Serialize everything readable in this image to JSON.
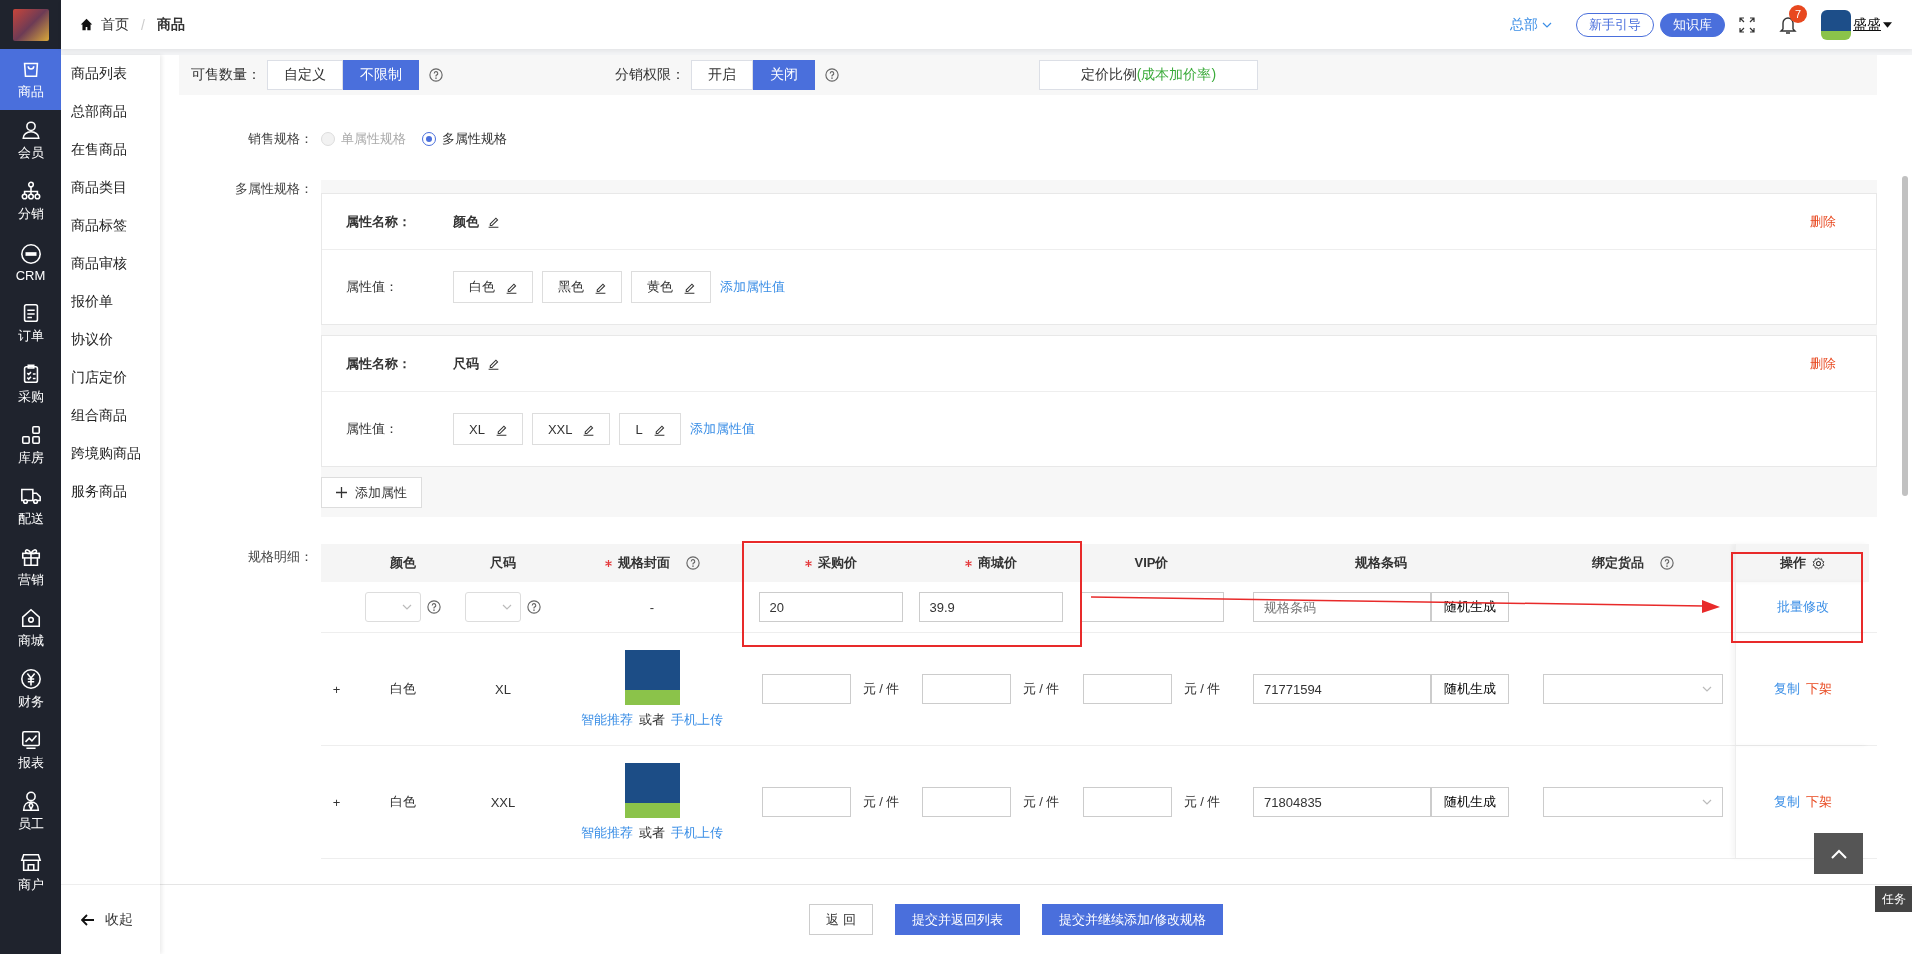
{
  "header": {
    "breadcrumb": [
      {
        "label": "首页"
      },
      {
        "label": "商品"
      }
    ],
    "breadcrumb_separator": "/",
    "org": "总部",
    "guide_button": "新手引导",
    "kb_button": "知识库",
    "notifications": "7",
    "user": "盛盛"
  },
  "nav": [
    {
      "label": "商品",
      "selected": true
    },
    {
      "label": "会员",
      "selected": false
    },
    {
      "label": "分销",
      "selected": false
    },
    {
      "label": "CRM",
      "selected": false
    },
    {
      "label": "订单",
      "selected": false
    },
    {
      "label": "采购",
      "selected": false
    },
    {
      "label": "库房",
      "selected": false
    },
    {
      "label": "配送",
      "selected": false
    },
    {
      "label": "营销",
      "selected": false
    },
    {
      "label": "商城",
      "selected": false
    },
    {
      "label": "财务",
      "selected": false
    },
    {
      "label": "报表",
      "selected": false
    },
    {
      "label": "员工",
      "selected": false
    },
    {
      "label": "商户",
      "selected": false
    }
  ],
  "subnav": {
    "items": [
      {
        "label": "商品列表",
        "selected": false
      },
      {
        "label": "总部商品",
        "selected": false
      },
      {
        "label": "在售商品",
        "selected": false
      },
      {
        "label": "商品类目",
        "selected": false
      },
      {
        "label": "商品标签",
        "selected": false
      },
      {
        "label": "商品审核",
        "selected": false
      },
      {
        "label": "报价单",
        "selected": false
      },
      {
        "label": "协议价",
        "selected": false
      },
      {
        "label": "门店定价",
        "selected": false
      },
      {
        "label": "组合商品",
        "selected": false
      },
      {
        "label": "跨境购商品",
        "selected": false
      },
      {
        "label": "服务商品",
        "selected": false
      }
    ],
    "collapse": "收起"
  },
  "filters": {
    "quantity": {
      "label": "可售数量：",
      "options": [
        {
          "label": "自定义",
          "selected": false
        },
        {
          "label": "不限制",
          "selected": true
        }
      ]
    },
    "distribution": {
      "label": "分销权限：",
      "options": [
        {
          "label": "开启",
          "selected": false
        },
        {
          "label": "关闭",
          "selected": true
        }
      ]
    },
    "pricing_button": {
      "label": "定价比例",
      "note": "(成本加价率)"
    }
  },
  "spec_type": {
    "label": "销售规格：",
    "options": [
      {
        "label": "单属性规格",
        "selected": false,
        "disabled": true
      },
      {
        "label": "多属性规格",
        "selected": true,
        "disabled": false
      }
    ]
  },
  "attributes": {
    "label": "多属性规格：",
    "items": [
      {
        "name_label": "属性名称：",
        "name": "颜色",
        "delete": "删除",
        "values_label": "属性值：",
        "values": [
          "白色",
          "黑色",
          "黄色"
        ],
        "add_value": "添加属性值"
      },
      {
        "name_label": "属性名称：",
        "name": "尺码",
        "delete": "删除",
        "values_label": "属性值：",
        "values": [
          "XL",
          "XXL",
          "L"
        ],
        "add_value": "添加属性值"
      }
    ],
    "add_button": "添加属性"
  },
  "spec_table": {
    "label": "规格明细：",
    "columns": [
      {
        "label": "颜色",
        "required": false,
        "help": false
      },
      {
        "label": "尺码",
        "required": false,
        "help": false
      },
      {
        "label": "规格封面",
        "required": true,
        "help": true
      },
      {
        "label": "采购价",
        "required": true,
        "help": false
      },
      {
        "label": "商城价",
        "required": true,
        "help": false
      },
      {
        "label": "VIP价",
        "required": false,
        "help": false
      },
      {
        "label": "规格条码",
        "required": false,
        "help": false
      },
      {
        "label": "绑定货品",
        "required": false,
        "help": true
      },
      {
        "label": "操作",
        "required": false,
        "help": false,
        "settings": true
      }
    ],
    "batch_row": {
      "cover": "-",
      "purchase": "20",
      "mall": "39.9",
      "barcode_placeholder": "规格条码",
      "generate": "随机生成",
      "action": "批量修改"
    },
    "rows": [
      {
        "expand": "+",
        "spec_color": "白色",
        "size": "XL",
        "recommend": "智能推荐",
        "or": "或者",
        "upload": "手机上传",
        "units": [
          "元 / 件",
          "元 / 件",
          "元 / 件"
        ],
        "barcode": "71771594",
        "generate": "随机生成",
        "copy": "复制",
        "off_shelf": "下架"
      },
      {
        "expand": "+",
        "spec_color": "白色",
        "size": "XXL",
        "recommend": "智能推荐",
        "or": "或者",
        "upload": "手机上传",
        "units": [
          "元 / 件",
          "元 / 件",
          "元 / 件"
        ],
        "barcode": "71804835",
        "generate": "随机生成",
        "copy": "复制",
        "off_shelf": "下架"
      }
    ]
  },
  "bottom_buttons": [
    {
      "label": "返 回",
      "kind": "default"
    },
    {
      "label": "提交并返回列表",
      "kind": "primary"
    },
    {
      "label": "提交并继续添加/修改规格",
      "kind": "primary"
    }
  ],
  "task_tab": "任务"
}
